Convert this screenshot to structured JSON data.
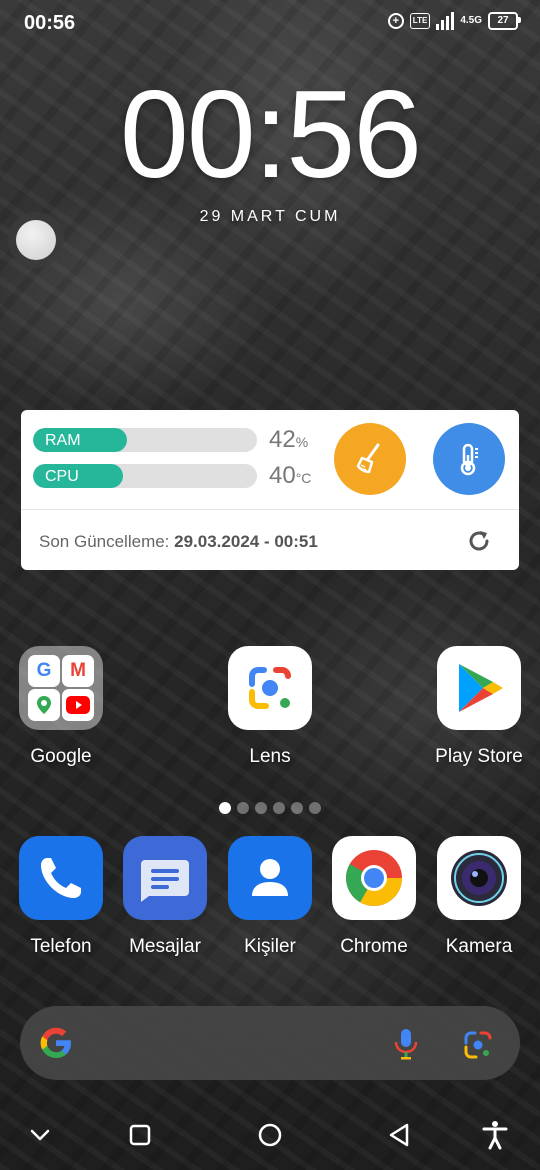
{
  "status_bar": {
    "time": "00:56",
    "network": "4.5G",
    "lte": "LTE",
    "battery": "27"
  },
  "clock": {
    "time": "00:56",
    "date": "29 MART CUM"
  },
  "widget": {
    "ram": {
      "label": "RAM",
      "value": "42",
      "unit": "%",
      "fraction": 0.42
    },
    "cpu": {
      "label": "CPU",
      "value": "40",
      "unit": "°C",
      "fraction": 0.4
    },
    "last_update_label": "Son Güncelleme:",
    "last_update_value": "29.03.2024 - 00:51"
  },
  "apps": {
    "google": "Google",
    "lens": "Lens",
    "play_store": "Play Store",
    "telefon": "Telefon",
    "mesajlar": "Mesajlar",
    "kisiler": "Kişiler",
    "chrome": "Chrome",
    "kamera": "Kamera"
  },
  "page_indicator": {
    "count": 6,
    "active": 0
  },
  "colors": {
    "accent_green": "#26b79a",
    "clean_orange": "#f5a623",
    "temp_blue": "#3f8de6"
  },
  "icons": [
    "add-circle-icon",
    "lte-icon",
    "signal-icon",
    "battery-icon",
    "broom-icon",
    "thermometer-icon",
    "refresh-icon",
    "google-g-icon",
    "mic-icon",
    "lens-icon",
    "chevron-down-icon",
    "recents-icon",
    "home-icon",
    "back-icon",
    "accessibility-icon"
  ]
}
